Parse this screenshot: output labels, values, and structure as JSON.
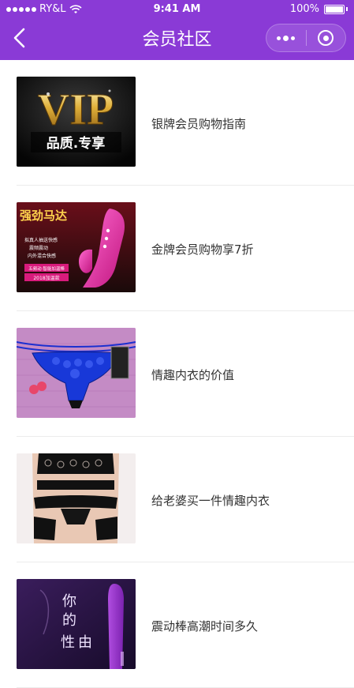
{
  "status_bar": {
    "carrier": "RY&L",
    "time": "9:41 AM",
    "battery": "100%"
  },
  "nav": {
    "title": "会员社区"
  },
  "articles": [
    {
      "title": "银牌会员购物指南",
      "thumb_text": [
        "VIP",
        "品质.专享"
      ]
    },
    {
      "title": "金牌会员购物享7折",
      "thumb_text": [
        "强劲马达",
        "拟真人抽送快感",
        "震频震动",
        "内外混合快感",
        "五频动·智能加温棒",
        "2018加温款"
      ]
    },
    {
      "title": "情趣内衣的价值"
    },
    {
      "title": "给老婆买一件情趣内衣"
    },
    {
      "title": "震动棒高潮时间多久",
      "thumb_text": [
        "你的",
        "性由"
      ]
    }
  ],
  "colors": {
    "header": "#8a3ad6",
    "text": "#333333",
    "divider": "#ececec"
  }
}
